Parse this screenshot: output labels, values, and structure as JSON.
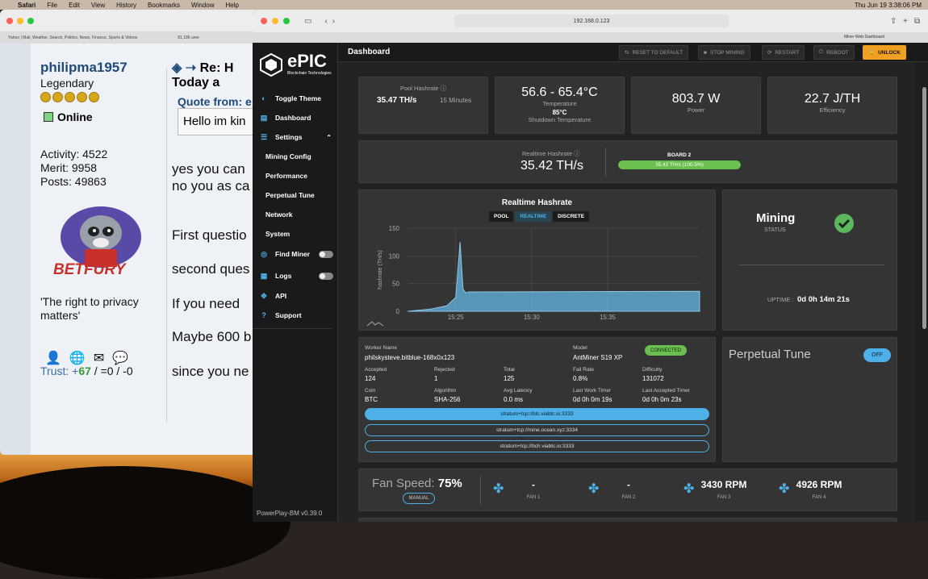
{
  "menubar": {
    "apple": "",
    "app": "Safari",
    "items": [
      "File",
      "Edit",
      "View",
      "History",
      "Bookmarks",
      "Window",
      "Help"
    ],
    "clock": "Thu Jun 19  3:38:06 PM"
  },
  "back_window": {
    "tab1": "Yahoo | Mail, Weather, Search, Politics, News, Finance, Sports & Videos",
    "tab2": "81,186 unre",
    "username": "philipma1957",
    "rank": "Legendary",
    "status": "Online",
    "activity": "Activity: 4522",
    "merit": "Merit: 9958",
    "posts": "Posts: 49863",
    "betfury": "BETFURY",
    "quote": "'The right to privacy matters'",
    "trust_label": "Trust: +",
    "trust_pos": "67",
    "trust_rest": " / =0 / -0",
    "post_title": "Re: H",
    "post_date": "Today a",
    "quote_from": "Quote from: e",
    "quote_text": "Hello im kin",
    "lines": [
      "yes you can",
      "no you as ca",
      "First questio",
      "second ques",
      "If you need",
      "Maybe 600 b",
      "since you ne"
    ]
  },
  "browser": {
    "address": "192.168.0.123",
    "tab_label": "Miner Web Dashboard"
  },
  "sidebar": {
    "brand": "ePIC",
    "brand_sub": "Blockchain Technologies",
    "toggle_theme": "Toggle Theme",
    "dashboard": "Dashboard",
    "settings": "Settings",
    "mining_config": "Mining Config",
    "performance": "Performance",
    "perpetual_tune": "Perpetual Tune",
    "network": "Network",
    "system": "System",
    "find_miner": "Find Miner",
    "logs": "Logs",
    "api": "API",
    "support": "Support",
    "version": "PowerPlay-BM v0.39.0"
  },
  "topbar": {
    "title": "Dashboard",
    "reset": "RESET TO DEFAULT",
    "stop": "STOP MINING",
    "restart": "RESTART",
    "reboot": "REBOOT",
    "unlock": "UNLOCK"
  },
  "stats": {
    "pool_hashrate_label": "Pool Hashrate",
    "pool_hashrate": "35.47 TH/s",
    "pool_window": "15 Minutes",
    "temp": "56.6 - 65.4°C",
    "temp_label": "Temperature",
    "shutdown": "85°C",
    "shutdown_label": "Shutdown Temperature",
    "power": "803.7 W",
    "power_label": "Power",
    "efficiency": "22.7 J/TH",
    "efficiency_label": "Efficiency"
  },
  "realtime": {
    "label": "Realtime Hashrate",
    "value": "35.42 TH/s",
    "board_label": "BOARD 2",
    "board_value": "35.42 TH/s (100.5%)",
    "board_pct": 100
  },
  "chart": {
    "title": "Realtime Hashrate",
    "btn_pool": "POOL",
    "btn_realtime": "REALTIME",
    "btn_discrete": "DISCRETE",
    "ylabel": "hashrate (TH/s)"
  },
  "chart_data": {
    "type": "area",
    "title": "Realtime Hashrate",
    "ylabel": "hashrate (TH/s)",
    "ylim": [
      0,
      150
    ],
    "yticks": [
      "150",
      "100",
      "50",
      "0"
    ],
    "xticks": [
      "15:25",
      "15:30",
      "15:35"
    ],
    "grid": true,
    "x": [
      0,
      1.6,
      2.7,
      3.3,
      3.6,
      3.8,
      4.0,
      4.2,
      4.5,
      20
    ],
    "y": [
      0,
      4,
      10,
      25,
      125,
      40,
      33,
      35,
      35,
      36
    ],
    "color": "#5fa8cf"
  },
  "status": {
    "title": "Mining",
    "label": "STATUS",
    "uptime_label": "UPTIME :",
    "uptime": "0d 0h 14m 21s"
  },
  "worker": {
    "worker_name_label": "Worker Name",
    "worker_name": "philskysteve.bitblue-168x0x123",
    "model_label": "Model",
    "model": "AntMiner S19 XP",
    "connected": "CONNECTED",
    "accepted_label": "Accepted",
    "accepted": "124",
    "rejected_label": "Rejected",
    "rejected": "1",
    "total_label": "Total",
    "total": "125",
    "failrate_label": "Fail Rate",
    "failrate": "0.8%",
    "difficulty_label": "Difficulty",
    "difficulty": "131072",
    "coin_label": "Coin",
    "coin": "BTC",
    "algo_label": "Algorithm",
    "algo": "SHA-256",
    "latency_label": "Avg Latency",
    "latency": "0.0 ms",
    "lastwork_label": "Last Work Timer",
    "lastwork": "0d 0h 0m 19s",
    "lastacc_label": "Last Accepted Timer",
    "lastacc": "0d 0h 0m 23s",
    "pools": [
      "stratum+tcp://btc.viabtc.io:3333",
      "stratum+tcp://mine.ocean.xyz:3334",
      "stratum+tcp://bch.viabtc.io:3333"
    ]
  },
  "perpetual": {
    "title": "Perpetual Tune",
    "state": "OFF"
  },
  "fans": {
    "label": "Fan Speed:",
    "pct": "75%",
    "mode": "MANUAL",
    "items": [
      {
        "v": "-",
        "l": "FAN 1"
      },
      {
        "v": "-",
        "l": "FAN 2"
      },
      {
        "v": "3430 RPM",
        "l": "FAN 3"
      },
      {
        "v": "4926 RPM",
        "l": "FAN 4"
      }
    ]
  }
}
